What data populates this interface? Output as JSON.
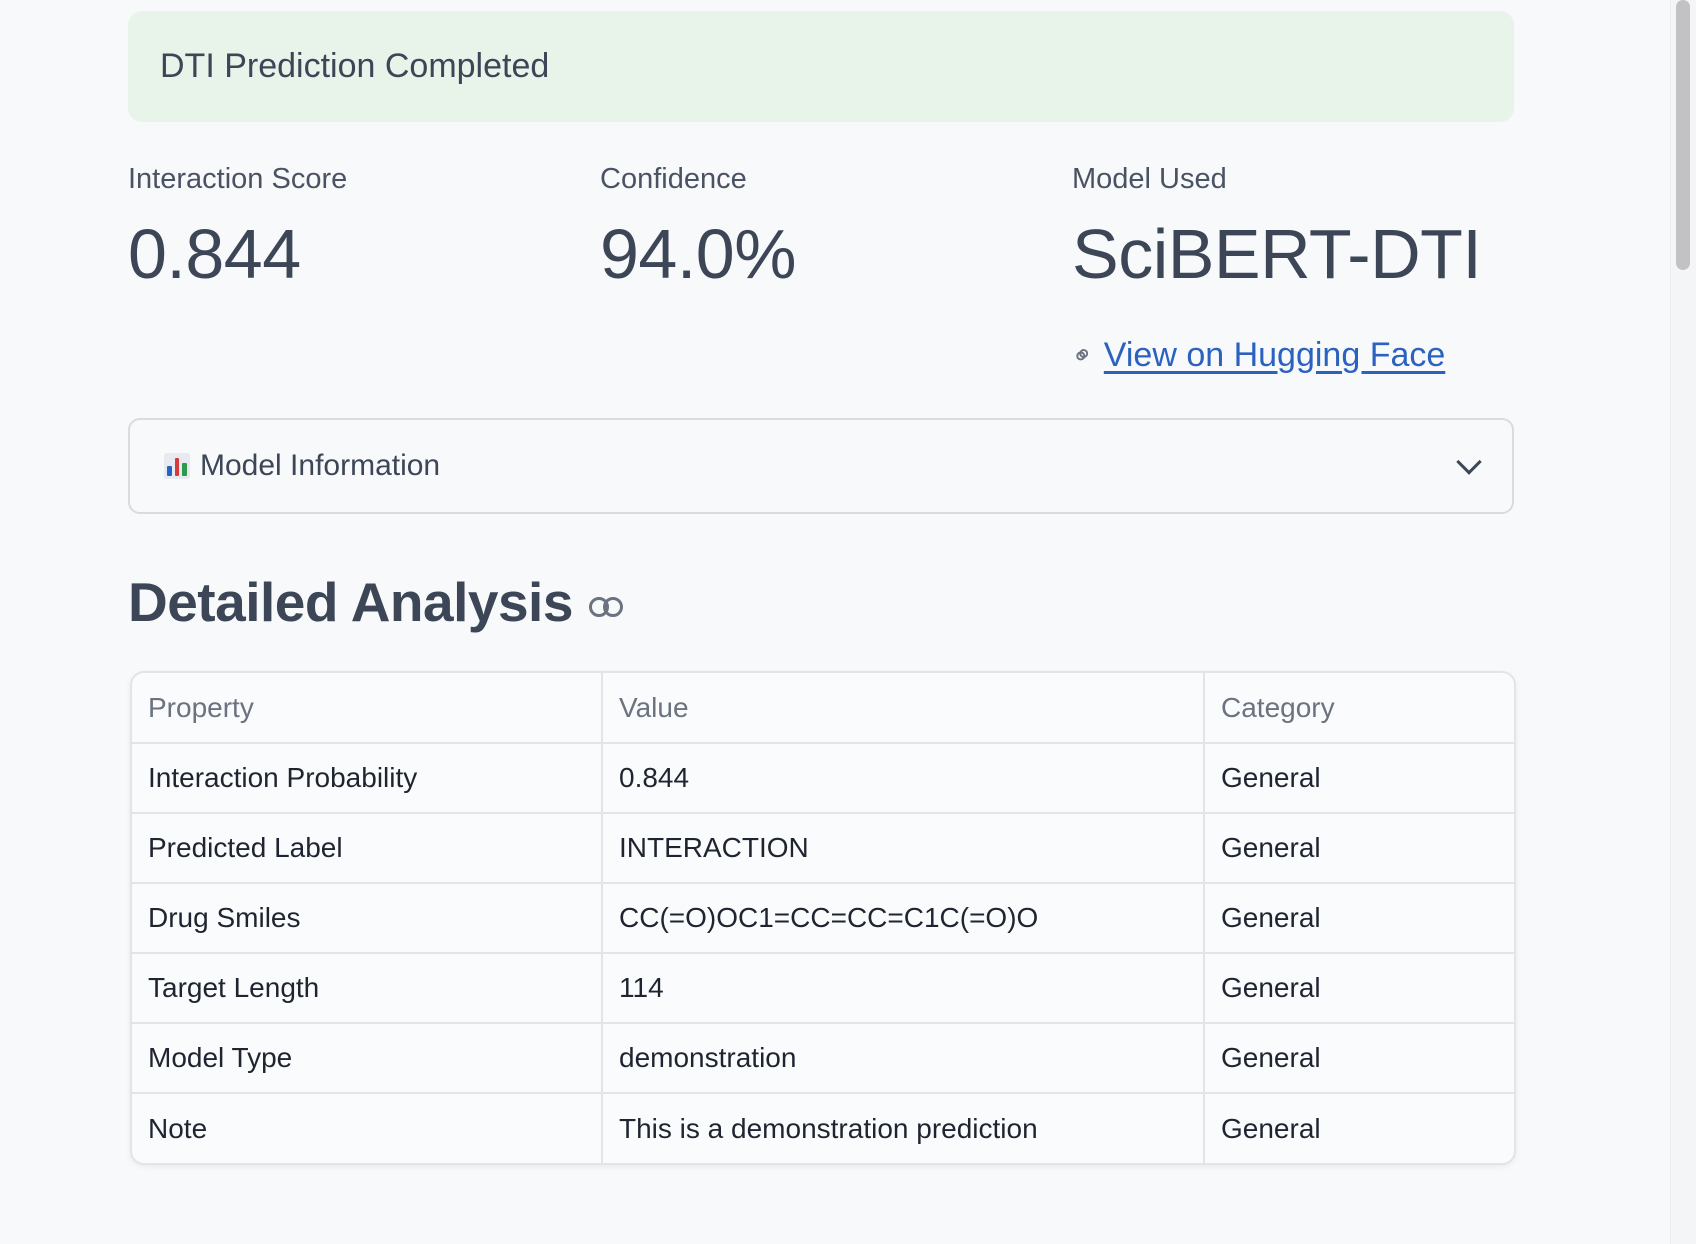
{
  "banner": {
    "text": "DTI Prediction Completed"
  },
  "metrics": {
    "interaction_score": {
      "label": "Interaction Score",
      "value": "0.844"
    },
    "confidence": {
      "label": "Confidence",
      "value": "94.0%"
    },
    "model_used": {
      "label": "Model Used",
      "value": "SciBERT-DTI"
    }
  },
  "model_link": {
    "icon": "link-icon",
    "text": "View on Hugging Face"
  },
  "expander": {
    "icon": "bar-chart-icon",
    "label": "Model Information",
    "state": "collapsed"
  },
  "section": {
    "title": "Detailed Analysis"
  },
  "table": {
    "headers": [
      "Property",
      "Value",
      "Category"
    ],
    "rows": [
      [
        "Interaction Probability",
        "0.844",
        "General"
      ],
      [
        "Predicted Label",
        "INTERACTION",
        "General"
      ],
      [
        "Drug Smiles",
        "CC(=O)OC1=CC=CC=C1C(=O)O",
        "General"
      ],
      [
        "Target Length",
        "114",
        "General"
      ],
      [
        "Model Type",
        "demonstration",
        "General"
      ],
      [
        "Note",
        "This is a demonstration prediction",
        "General"
      ]
    ]
  },
  "colors": {
    "banner_bg": "#e8f3ea",
    "link": "#2b62c0",
    "text": "#3c4656",
    "background": "#f8f9fb"
  }
}
